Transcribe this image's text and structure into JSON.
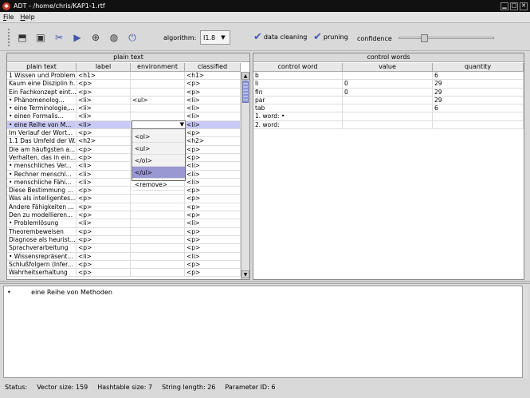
{
  "window": {
    "title": "ADT - /home/chris/KAP1-1.rtf"
  },
  "menu": [
    "File",
    "Help"
  ],
  "toolbar": {
    "icons": [
      "open-icon",
      "save-icon",
      "tools-icon",
      "play-icon",
      "zoom-icon",
      "globe-icon",
      "power-icon"
    ],
    "algorithm_label": "algorithm:",
    "algorithm_value": "I1.8",
    "data_cleaning_label": "data cleaning",
    "pruning_label": "pruning",
    "confidence_label": "confidence",
    "confidence_level": 0.25
  },
  "plain_text": {
    "title": "plain text",
    "columns": [
      "plain text",
      "label",
      "environment",
      "classified"
    ],
    "rows": [
      [
        "1 Wissen und Problem...",
        "<h1>",
        "",
        "<h1>"
      ],
      [
        "Kaum eine Disziplin h...",
        "<p>",
        "",
        "<p>"
      ],
      [
        "Ein Fachkonzept eint...",
        "<p>",
        "",
        "<p>"
      ],
      [
        "• Phänomenolog...",
        "<li>",
        "<ul>",
        "<li>"
      ],
      [
        "• eine Terminologie,...",
        "<li>",
        "",
        "<li>"
      ],
      [
        "• einen Formalis...",
        "<li>",
        "",
        "<li>"
      ],
      [
        "• eine Reihe von M...",
        "<li>",
        "",
        "<li>"
      ],
      [
        "Im Verlauf der Wort...",
        "<p>",
        "",
        "<p>"
      ],
      [
        "1.1 Das Umfeld der W...",
        "<h2>",
        "",
        "<h2>"
      ],
      [
        "Die am häufigsten a...",
        "<p>",
        "",
        "<p>"
      ],
      [
        "Verhalten, das in ein...",
        "<p>",
        "",
        "<p>"
      ],
      [
        "• menschliches Ver...",
        "<li>",
        "",
        "<li>"
      ],
      [
        "• Rechner menschl...",
        "<li>",
        "",
        "<li>"
      ],
      [
        "• menschliche Fähi...",
        "<li>",
        "",
        "<li>"
      ],
      [
        "Diese Bestimmung ...",
        "<p>",
        "",
        "<p>"
      ],
      [
        "Was als intelligentes...",
        "<p>",
        "",
        "<p>"
      ],
      [
        "Andere Fähigkeiten ...",
        "<p>",
        "",
        "<p>"
      ],
      [
        "Den zu modellieren...",
        "<p>",
        "",
        "<p>"
      ],
      [
        "• Problemlösung",
        "<li>",
        "",
        "<li>"
      ],
      [
        "Theorembeweisen",
        "<p>",
        "",
        "<p>"
      ],
      [
        "Diagnose als heurist...",
        "<p>",
        "",
        "<p>"
      ],
      [
        "Sprachverarbeitung",
        "<p>",
        "",
        "<p>"
      ],
      [
        "• Wissensrepräsent...",
        "<li>",
        "",
        "<li>"
      ],
      [
        "Schlußfolgern (Infer...",
        "<p>",
        "",
        "<p>"
      ],
      [
        "Wahrheitserhaltung",
        "<p>",
        "",
        "<p>"
      ]
    ],
    "selected_row": 6,
    "dropdown_options": [
      "<ol>",
      "<ul>",
      "</ol>",
      "</ul>",
      "<remove>"
    ],
    "dropdown_highlight": 3
  },
  "control_words": {
    "title": "control words",
    "columns": [
      "control word",
      "value",
      "quantity"
    ],
    "rows": [
      [
        "b",
        "",
        "6"
      ],
      [
        "li",
        "0",
        "29"
      ],
      [
        "fin",
        "0",
        "29"
      ],
      [
        "par",
        "",
        "29"
      ],
      [
        "tab",
        "",
        "6"
      ],
      [
        "1. word: •",
        "",
        ""
      ],
      [
        "2. word:",
        "",
        ""
      ]
    ]
  },
  "bottom": {
    "text": "•          eine Reihe von Methoden"
  },
  "status": {
    "label": "Status:",
    "vector_size": "Vector size: 159",
    "hashtable_size": "Hashtable size: 7",
    "string_length": "String length: 26",
    "parameter_id": "Parameter ID: 6"
  }
}
